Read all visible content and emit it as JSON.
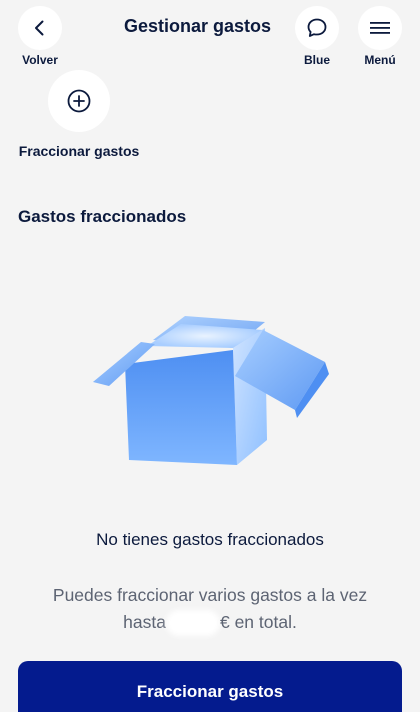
{
  "header": {
    "title": "Gestionar gastos",
    "back_label": "Volver",
    "blue_label": "Blue",
    "menu_label": "Menú",
    "icons": {
      "back": "chevron-left-icon",
      "blue": "chat-bubble-icon",
      "menu": "hamburger-menu-icon"
    }
  },
  "actions": [
    {
      "label": "Fraccionar gastos",
      "icon": "plus-circle-icon"
    }
  ],
  "section": {
    "title": "Gastos fraccionados"
  },
  "empty_state": {
    "title": "No tienes gastos fraccionados",
    "desc_line1": "Puedes fraccionar varios gastos a la vez",
    "desc_prefix": "hasta",
    "desc_suffix": "€ en total.",
    "illustration": "open-box-illustration"
  },
  "cta": {
    "label": "Fraccionar gastos"
  },
  "colors": {
    "primary": "#041b8e",
    "text": "#0c1a3d",
    "muted": "#5d6473",
    "background": "#f4f4f4",
    "box_blue": "#4a8cf0"
  }
}
